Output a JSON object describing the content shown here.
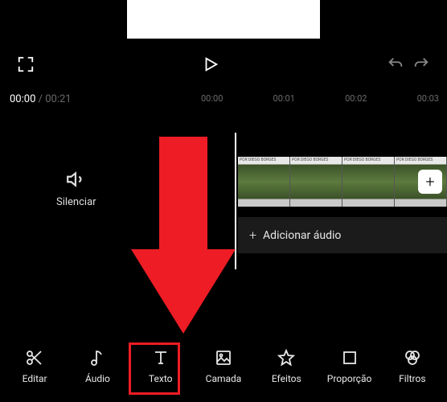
{
  "time": {
    "current": "00:00",
    "total": "00:21",
    "separator": " / "
  },
  "ruler": [
    "00:00",
    "00:01",
    "00:02",
    "00:03"
  ],
  "mute_label": "Silenciar",
  "clip_watermark": "POR DIEGO BORGES",
  "audio_track": {
    "add_label": "Adicionar áudio"
  },
  "toolbar": [
    {
      "id": "editar",
      "label": "Editar"
    },
    {
      "id": "audio",
      "label": "Áudio"
    },
    {
      "id": "texto",
      "label": "Texto"
    },
    {
      "id": "camada",
      "label": "Camada"
    },
    {
      "id": "efeitos",
      "label": "Efeitos"
    },
    {
      "id": "proporcao",
      "label": "Proporção"
    },
    {
      "id": "filtros",
      "label": "Filtros"
    }
  ],
  "colors": {
    "highlight": "#ee1c25",
    "bg": "#000000"
  }
}
